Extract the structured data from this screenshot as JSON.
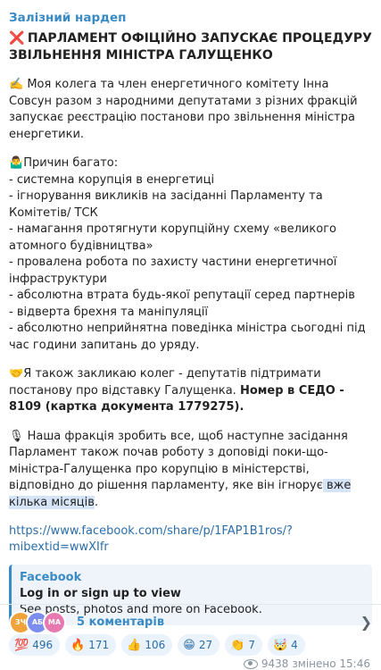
{
  "channel": {
    "name": "Залізний нардеп"
  },
  "headline": {
    "emoji": "❌",
    "text": "ПАРЛАМЕНТ ОФІЦІЙНО ЗАПУСКАЄ ПРОЦЕДУРУ ЗВІЛЬНЕННЯ МІНІСТРА ГАЛУЩЕНКО"
  },
  "body": {
    "p1_emoji": "✍️",
    "p1": " Моя колега та член енергетичного комітету Інна Совсун разом з народними депутатами з різних фракцій запускає реєстрацію постанови про звільнення міністра енергетики.",
    "p2_emoji": "🤷‍♂️",
    "p2": "Причин багато:",
    "reasons": [
      "- системна корупція в енергетиці",
      "- ігнорування викликів на засіданні Парламенту та Комітетів/ ТСК",
      "- намагання протягнути корупційну схему «великого атомного будівництва»",
      "- провалена робота по захисту частини енергетичної інфраструктури",
      "- абсолютна втрата будь-якої репутації серед партнерів",
      "- відверта брехня та маніпуляції",
      "- абсолютно неприйнятна поведінка міністра сьогодні під час години запитань до уряду."
    ],
    "p3_emoji": "🤝",
    "p3": "Я також закликаю колег - депутатів  підтримати постанову про відставку Галущенка. ",
    "p3_bold": "Номер в СЕДО - 8109 (картка документа 1779275).",
    "p4_emoji": "🎙",
    "p4": " Наша фракція зробить все, щоб наступне засідання Парламент також почав роботу з доповіді поки-що-міністра-Галущенка про корупцію в міністерстві, відповідно до рішення парламенту, яке він ігнорує",
    "p4_hl": " вже кілька місяців",
    "p4_end": ".",
    "link": "https://www.facebook.com/share/p/1FAP1B1ros/?mibextid=wwXIfr"
  },
  "preview": {
    "site": "Facebook",
    "title": "Log in or sign up to view",
    "desc": "See posts, photos and more on Facebook."
  },
  "reactions": [
    {
      "emoji": "💯",
      "count": "496"
    },
    {
      "emoji": "🔥",
      "count": "171"
    },
    {
      "emoji": "👍",
      "count": "106"
    },
    {
      "emoji": "😁",
      "count": "27"
    },
    {
      "emoji": "👏",
      "count": "7"
    },
    {
      "emoji": "🤯",
      "count": "4"
    }
  ],
  "meta": {
    "views": "9438",
    "edited": "змінено 15:46"
  },
  "comments": {
    "label": "5 коментарів",
    "avatars": [
      {
        "initials": "ЗЧ",
        "color": "#f0a23b"
      },
      {
        "initials": "АБ",
        "color": "#7c8df0"
      },
      {
        "initials": "МА",
        "color": "#e879b0"
      }
    ]
  },
  "colors": {
    "accent": "#3a8bc5",
    "reaction_bg": "#eaf2fb"
  }
}
